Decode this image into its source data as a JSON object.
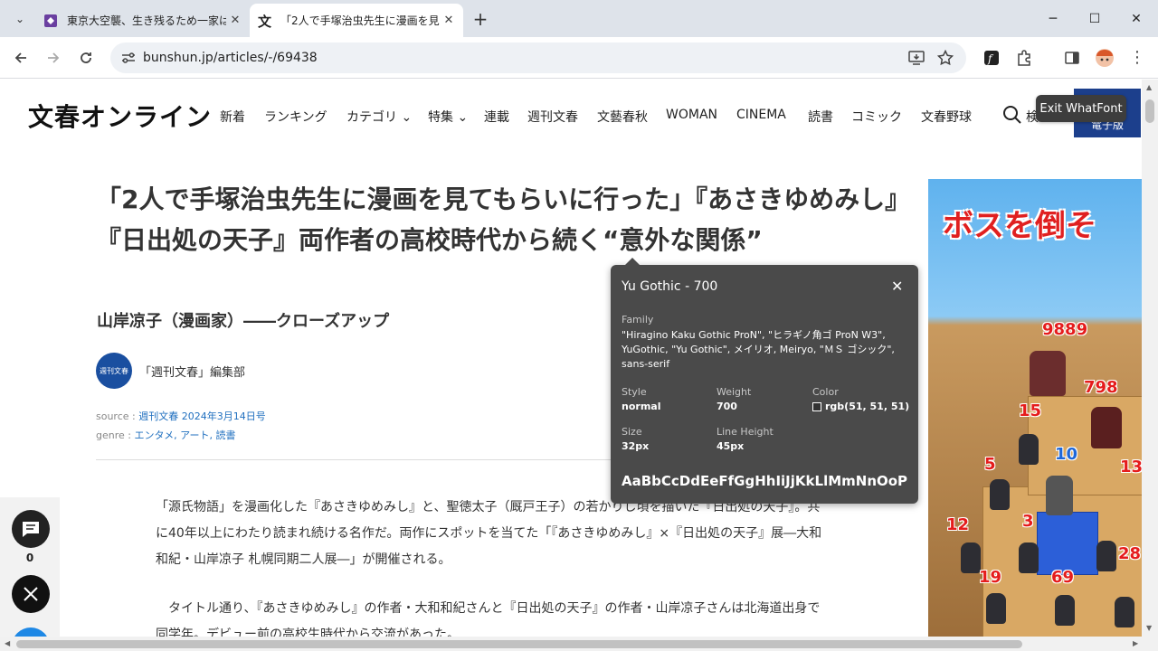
{
  "browser": {
    "tabs": [
      {
        "title": "東京大空襲、生き残るため一家は",
        "close": "✕"
      },
      {
        "title": "「2人で手塚治虫先生に漫画を見て",
        "close": "✕"
      }
    ],
    "new_tab": "+",
    "window": {
      "minimize": "─",
      "maximize": "☐",
      "close": "✕"
    },
    "url": "bunshun.jp/articles/-/69438"
  },
  "site": {
    "logo": "文春オンライン",
    "nav": [
      "新着",
      "ランキング",
      "カテゴリ",
      "特集",
      "連載",
      "週刊文春",
      "文藝春秋",
      "WOMAN",
      "CINEMA",
      "読書",
      "コミック",
      "文春野球"
    ],
    "search_label": "検",
    "ebook_label": "電子版"
  },
  "extension": {
    "exit_label": "Exit WhatFont",
    "popup": {
      "title": "Yu Gothic - 700",
      "family_label": "Family",
      "family_value": "\"Hiragino Kaku Gothic ProN\", \"ヒラギノ角ゴ ProN W3\", YuGothic, \"Yu Gothic\", メイリオ, Meiryo, \"ＭＳ ゴシック\", sans-serif",
      "style_label": "Style",
      "style_value": "normal",
      "weight_label": "Weight",
      "weight_value": "700",
      "color_label": "Color",
      "color_value": "rgb(51, 51, 51)",
      "size_label": "Size",
      "size_value": "32px",
      "lineheight_label": "Line Height",
      "lineheight_value": "45px",
      "sample": "AaBbCcDdEeFfGgHhIiJjKkLlMmNnOoPp"
    }
  },
  "article": {
    "title": "「2人で手塚治虫先生に漫画を見てもらいに行った」『あさきゆめみし』『日出処の天子』両作者の高校時代から続く“意外な関係”",
    "subtitle": "山岸凉子（漫画家）――クローズアップ",
    "author_logo": "週刊文春",
    "author": "「週刊文春」編集部",
    "source_label": "source : ",
    "source_value": "週刊文春 2024年3月14日号",
    "genre_label": "genre : ",
    "genre_value": "エンタメ, アート, 読書",
    "para1": "「源氏物語」を漫画化した『あさきゆめみし』と、聖徳太子（厩戸王子）の若かりし頃を描いた『日出処の天子』。共に40年以上にわたり読まれ続ける名作だ。両作にスポットを当てた「『あさきゆめみし』×『日出処の天子』展―大和和紀・山岸凉子 札幌同期二人展―」が開催される。",
    "para2": "　タイトル通り、『あさきゆめみし』の作者・大和和紀さんと『日出処の天子』の作者・山岸凉子さんは北海道出身で同学年。デビュー前の高校生時代から交流があった。"
  },
  "social": {
    "comment_count": "0"
  },
  "ad": {
    "headline": "ボスを倒そ",
    "numbers": [
      "9889",
      "798",
      "15",
      "10",
      "5",
      "13",
      "12",
      "3",
      "28",
      "19",
      "69"
    ]
  }
}
